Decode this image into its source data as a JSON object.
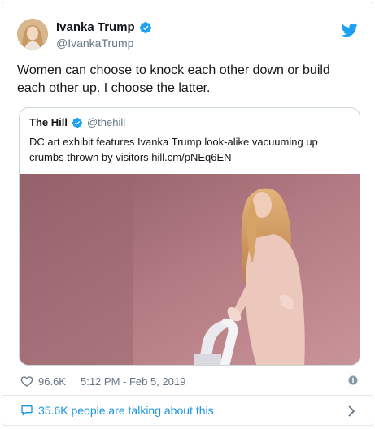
{
  "author": {
    "name": "Ivanka Trump",
    "handle": "@IvankaTrump"
  },
  "tweet": {
    "text": "Women can choose to knock each other down or build each other up. I choose the latter."
  },
  "quoted": {
    "name": "The Hill",
    "handle": "@thehill",
    "text": "DC art exhibit features Ivanka Trump look-alike vacuuming up crumbs thrown by visitors hill.cm/pNEq6EN"
  },
  "meta": {
    "likes": "96.6K",
    "timestamp": "5:12 PM - Feb 5, 2019"
  },
  "conversation": {
    "text": "35.6K people are talking about this"
  },
  "icons": {
    "brand": "twitter-bird-icon",
    "verified": "verified-badge-icon",
    "like": "heart-icon",
    "info": "info-icon",
    "conversation": "speech-bubble-icon",
    "chevron": "chevron-right-icon"
  },
  "colors": {
    "accent": "#1da1f2",
    "link": "#1b95e0",
    "secondary_text": "#657786",
    "border": "#e1e8ed"
  }
}
